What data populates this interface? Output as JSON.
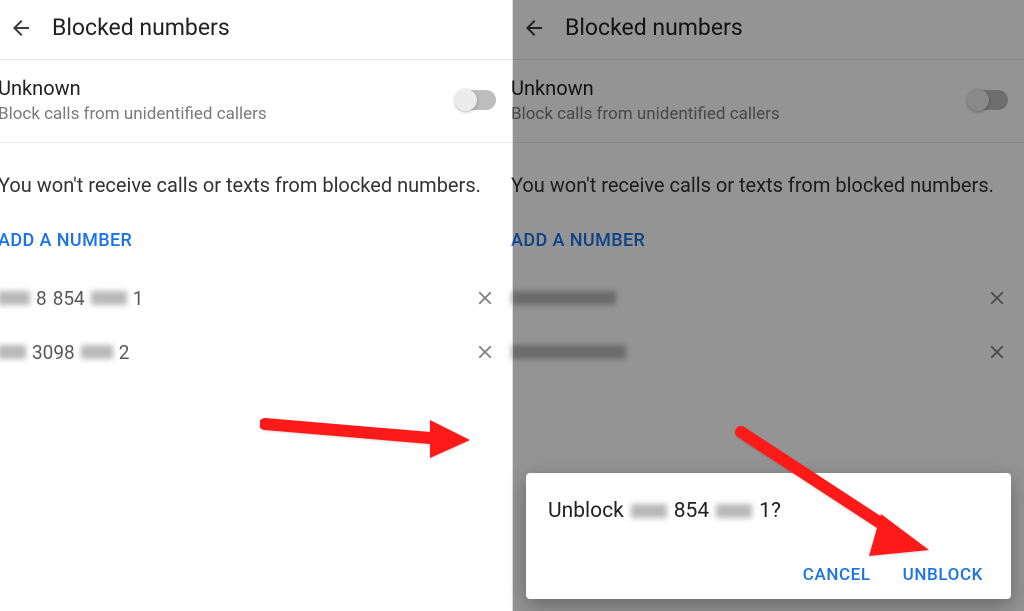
{
  "header": {
    "title": "Blocked numbers"
  },
  "unknown": {
    "title": "Unknown",
    "subtitle": "Block calls from unidentified callers",
    "toggled": false
  },
  "info_text": "You won't receive calls or texts from blocked numbers.",
  "add_number_label": "ADD A NUMBER",
  "numbers": [
    {
      "visible_mid": "854",
      "visible_end": "1"
    },
    {
      "visible_mid": "3098",
      "visible_end": "2"
    }
  ],
  "dialog": {
    "prefix": "Unblock",
    "visible_mid": "854",
    "visible_end": "1?",
    "cancel_label": "CANCEL",
    "confirm_label": "UNBLOCK"
  }
}
